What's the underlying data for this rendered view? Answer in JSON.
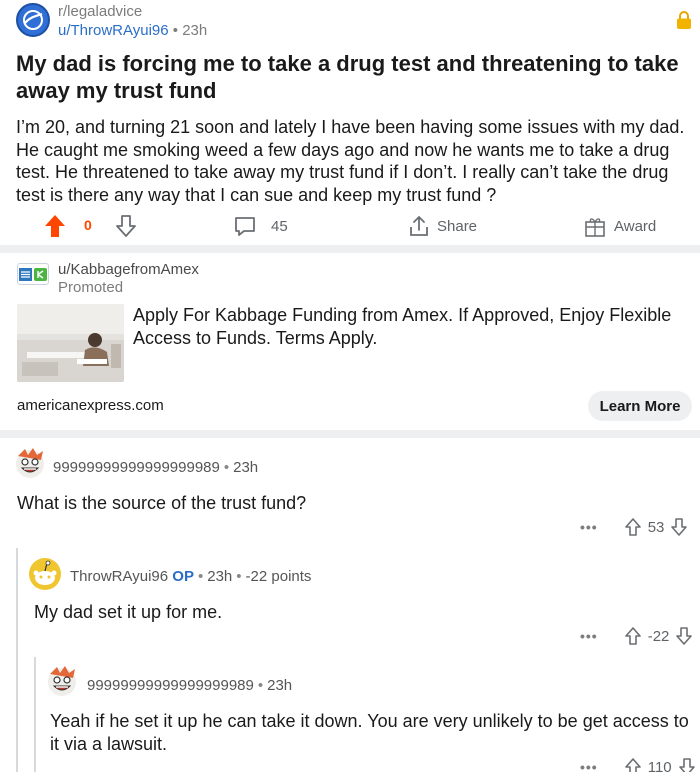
{
  "post": {
    "subreddit": "r/legaladvice",
    "author": "u/ThrowRAyui96",
    "time": "23h",
    "title": "My dad is forcing me to take a drug test and threatening to take away my trust fund",
    "body": "I’m 20, and turning 21 soon and lately I have been having some issues with my dad. He caught me smoking weed a few days ago and now he wants me to take a drug test. He threatened to take away my trust fund if I don’t. I really can’t take the drug test is there any way that I can sue and keep my trust fund ?",
    "vote_count": "0",
    "comment_count": "45",
    "share_label": "Share",
    "award_label": "Award"
  },
  "ad": {
    "user": "u/KabbagefromAmex",
    "promoted_label": "Promoted",
    "text": "Apply For Kabbage Funding from Amex. If Approved, Enjoy Flexible Access to Funds. Terms Apply.",
    "domain": "americanexpress.com",
    "button_label": "Learn More"
  },
  "comments": [
    {
      "author": "99999999999999999989",
      "time": "23h",
      "body": "What is the source of the trust fund?",
      "votes": "53"
    },
    {
      "author": "ThrowRAyui96",
      "op_label": "OP",
      "time": "23h",
      "points": "-22 points",
      "body": "My dad set it up for me.",
      "votes": "-22"
    },
    {
      "author": "99999999999999999989",
      "time": "23h",
      "body": "Yeah if he set it up he can take it down.  You are very unlikely to be get access to it via a lawsuit.",
      "votes": "110"
    }
  ],
  "colors": {
    "accent_orange": "#ff4500",
    "link_blue": "#2a6ec9",
    "divider": "#edeff1"
  }
}
